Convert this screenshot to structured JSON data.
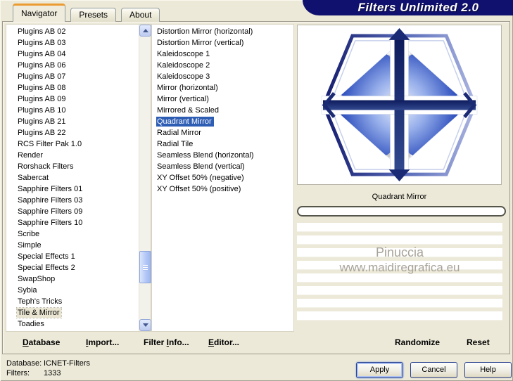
{
  "banner": {
    "title": "Filters Unlimited 2.0",
    "bg_color": "#10106e",
    "text_color": "#ffffff"
  },
  "tabs": [
    {
      "label": "Navigator",
      "state": "active"
    },
    {
      "label": "Presets"
    },
    {
      "label": "About"
    }
  ],
  "left_list": {
    "items": [
      {
        "label": "Plugins AB 02"
      },
      {
        "label": "Plugins AB 03"
      },
      {
        "label": "Plugins AB 04"
      },
      {
        "label": "Plugins AB 06"
      },
      {
        "label": "Plugins AB 07"
      },
      {
        "label": "Plugins AB 08"
      },
      {
        "label": "Plugins AB 09"
      },
      {
        "label": "Plugins AB 10"
      },
      {
        "label": "Plugins AB 21"
      },
      {
        "label": "Plugins AB 22"
      },
      {
        "label": "RCS Filter Pak 1.0"
      },
      {
        "label": "Render"
      },
      {
        "label": "Rorshack Filters"
      },
      {
        "label": "Sabercat"
      },
      {
        "label": "Sapphire Filters 01"
      },
      {
        "label": "Sapphire Filters 03"
      },
      {
        "label": "Sapphire Filters 09"
      },
      {
        "label": "Sapphire Filters 10"
      },
      {
        "label": "Scribe"
      },
      {
        "label": "Simple"
      },
      {
        "label": "Special Effects 1"
      },
      {
        "label": "Special Effects 2"
      },
      {
        "label": "SwapShop"
      },
      {
        "label": "Sybia"
      },
      {
        "label": "Teph's Tricks"
      },
      {
        "label": "Tile & Mirror",
        "state": "highlighted"
      },
      {
        "label": "Toadies"
      }
    ]
  },
  "filter_list": {
    "items": [
      {
        "label": "Distortion Mirror (horizontal)"
      },
      {
        "label": "Distortion Mirror (vertical)"
      },
      {
        "label": "Kaleidoscope 1"
      },
      {
        "label": "Kaleidoscope 2"
      },
      {
        "label": "Kaleidoscope 3"
      },
      {
        "label": "Mirror (horizontal)"
      },
      {
        "label": "Mirror (vertical)"
      },
      {
        "label": "Mirrored & Scaled"
      },
      {
        "label": "Quadrant Mirror",
        "state": "selected"
      },
      {
        "label": "Radial Mirror"
      },
      {
        "label": "Radial Tile"
      },
      {
        "label": "Seamless Blend (horizontal)"
      },
      {
        "label": "Seamless Blend (vertical)"
      },
      {
        "label": "XY Offset 50% (negative)"
      },
      {
        "label": "XY Offset 50% (positive)"
      }
    ]
  },
  "preview": {
    "caption": "Quadrant Mirror",
    "watermark_line1": "Pinuccia",
    "watermark_line2": "www.maidiregrafica.eu"
  },
  "toolbar": {
    "items": [
      {
        "pre": "",
        "key": "D",
        "post": "atabase"
      },
      {
        "pre": "",
        "key": "I",
        "post": "mport..."
      },
      {
        "pre": "Filter ",
        "key": "I",
        "post": "nfo..."
      },
      {
        "pre": "",
        "key": "E",
        "post": "ditor..."
      }
    ],
    "randomize": "Randomize",
    "reset": "Reset"
  },
  "status": {
    "database_label": "Database:",
    "database_value": "ICNET-Filters",
    "filters_label": "Filters:",
    "filters_value": "1333"
  },
  "buttons": {
    "apply": "Apply",
    "cancel": "Cancel",
    "help": "Help"
  },
  "colors": {
    "dialog_bg": "#ece9d8",
    "selection_blue": "#2e5db4",
    "banner_navy": "#10106e"
  }
}
